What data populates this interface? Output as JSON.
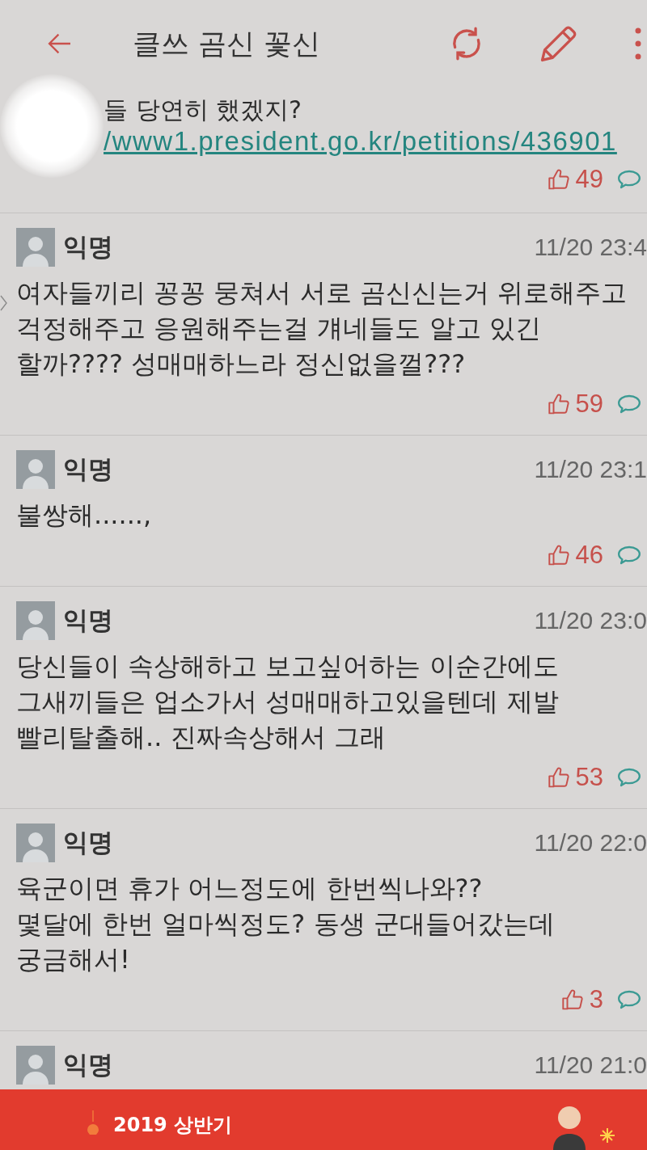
{
  "header": {
    "title": "클쓰 곰신 꽃신"
  },
  "partial_comment": {
    "text": "들 당연히 했겠지?",
    "link": "/www1.president.go.kr/petitions/436901",
    "likes": "49"
  },
  "comments": [
    {
      "author": "익명",
      "date": "11/20 23:4",
      "body": "여자들끼리 꽁꽁 뭉쳐서 서로 곰신신는거 위로해주고\n걱정해주고 응원해주는걸 걔네들도 알고 있긴\n할까???? 성매매하느라 정신없을껄???",
      "likes": "59"
    },
    {
      "author": "익명",
      "date": "11/20 23:1",
      "body": "불쌍해......,",
      "likes": "46"
    },
    {
      "author": "익명",
      "date": "11/20 23:0",
      "body": "당신들이 속상해하고 보고싶어하는 이순간에도\n그새끼들은 업소가서 성매매하고있을텐데 제발\n빨리탈출해.. 진짜속상해서 그래",
      "likes": "53"
    },
    {
      "author": "익명",
      "date": "11/20 22:0",
      "body": "육군이면 휴가 어느정도에 한번씩나와??\n몇달에 한번 얼마씩정도? 동생 군대들어갔는데\n궁금해서!",
      "likes": "3"
    },
    {
      "author": "익명",
      "date": "11/20 21:0"
    }
  ],
  "ad_banner": {
    "text": "2019 상반기"
  }
}
